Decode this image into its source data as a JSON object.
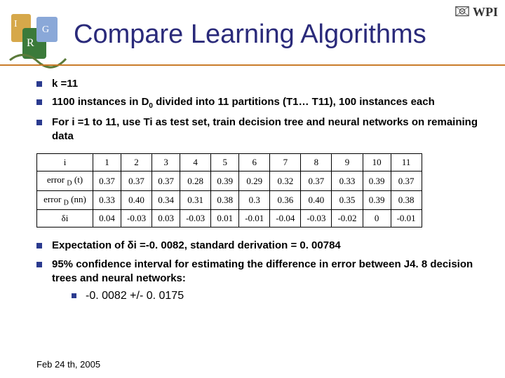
{
  "title": "Compare Learning Algorithms",
  "logo_right_text": "WPI",
  "bullets_top": [
    {
      "html": "k =11"
    },
    {
      "html": "1100 instances in D<sub class=\"sub\">0</sub> divided into 11 partitions (T1… T11), 100 instances each"
    },
    {
      "html": "For i =1 to 11, use Ti as test set, train decision tree and neural networks on remaining data"
    }
  ],
  "table": {
    "header": [
      "i",
      "1",
      "2",
      "3",
      "4",
      "5",
      "6",
      "7",
      "8",
      "9",
      "10",
      "11"
    ],
    "rows": [
      {
        "label_html": "error <sub class=\"sub\">D</sub> (t)",
        "cells": [
          "0.37",
          "0.37",
          "0.37",
          "0.28",
          "0.39",
          "0.29",
          "0.32",
          "0.37",
          "0.33",
          "0.39",
          "0.37"
        ]
      },
      {
        "label_html": "error <sub class=\"sub\">D</sub> (nn)",
        "cells": [
          "0.33",
          "0.40",
          "0.34",
          "0.31",
          "0.38",
          "0.3",
          "0.36",
          "0.40",
          "0.35",
          "0.39",
          "0.38"
        ]
      },
      {
        "label_html": "δi",
        "cells": [
          "0.04",
          "-0.03",
          "0.03",
          "-0.03",
          "0.01",
          "-0.01",
          "-0.04",
          "-0.03",
          "-0.02",
          "0",
          "-0.01"
        ]
      }
    ]
  },
  "bullets_bottom": [
    {
      "html": "Expectation of δi =-0. 0082, standard derivation = 0. 00784"
    },
    {
      "html": "95% confidence interval for estimating the difference in error between J4. 8 decision trees and neural networks:",
      "sub": [
        "-0. 0082 +/- 0. 0175"
      ]
    }
  ],
  "footer_date": "Feb 24 th, 2005",
  "chart_data": {
    "type": "table",
    "columns": [
      "i",
      "1",
      "2",
      "3",
      "4",
      "5",
      "6",
      "7",
      "8",
      "9",
      "10",
      "11"
    ],
    "rows": [
      [
        "error_D(t)",
        0.37,
        0.37,
        0.37,
        0.28,
        0.39,
        0.29,
        0.32,
        0.37,
        0.33,
        0.39,
        0.37
      ],
      [
        "error_D(nn)",
        0.33,
        0.4,
        0.34,
        0.31,
        0.38,
        0.3,
        0.36,
        0.4,
        0.35,
        0.39,
        0.38
      ],
      [
        "delta_i",
        0.04,
        -0.03,
        0.03,
        -0.03,
        0.01,
        -0.01,
        -0.04,
        -0.03,
        -0.02,
        0,
        -0.01
      ]
    ],
    "expectation_delta_i": -0.0082,
    "std_dev": 0.00784,
    "confidence_interval_95": [
      -0.0082,
      0.0175
    ]
  }
}
